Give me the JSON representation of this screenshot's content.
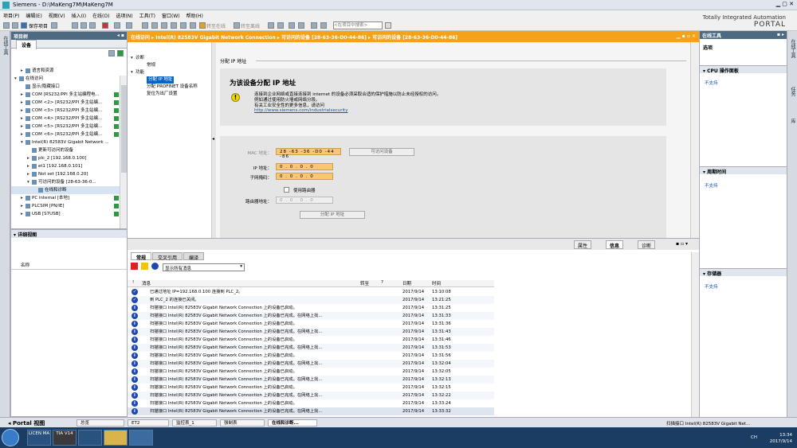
{
  "window": {
    "title": "Siemens  -  D:\\MaKeng7M\\MaKeng7M"
  },
  "menu": [
    "项目(P)",
    "编辑(E)",
    "视图(V)",
    "插入(I)",
    "在线(O)",
    "选项(N)",
    "工具(T)",
    "窗口(W)",
    "帮助(H)"
  ],
  "toolbar": {
    "save_project": "保存项目",
    "goto_online": "转至在线",
    "goto_offline": "转至离线",
    "search_placeholder": "<在项目中搜索>"
  },
  "brand": {
    "line1": "Totally Integrated Automation",
    "line2": "PORTAL"
  },
  "left_strip": {
    "label": "在线工具"
  },
  "project_tree": {
    "title": "项目树",
    "tab": "设备",
    "items": [
      {
        "label": "语言和资源",
        "indent": 1,
        "expand": "▸"
      },
      {
        "label": "在线访问",
        "indent": 0,
        "expand": "▾"
      },
      {
        "label": "显示/隐藏接口",
        "indent": 1,
        "expand": ""
      },
      {
        "label": "COM [RS232/PPI 多主站编程电...",
        "indent": 1,
        "expand": "▸"
      },
      {
        "label": "COM <2> [RS232/PPI 多主站编...",
        "indent": 1,
        "expand": "▸"
      },
      {
        "label": "COM <3> [RS232/PPI 多主站编...",
        "indent": 1,
        "expand": "▸"
      },
      {
        "label": "COM <4> [RS232/PPI 多主站编...",
        "indent": 1,
        "expand": "▸"
      },
      {
        "label": "COM <5> [RS232/PPI 多主站编...",
        "indent": 1,
        "expand": "▸"
      },
      {
        "label": "COM <6> [RS232/PPI 多主站编...",
        "indent": 1,
        "expand": "▸"
      },
      {
        "label": "Intel(R) 82583V Gigabit Network ...",
        "indent": 1,
        "expand": "▾"
      },
      {
        "label": "更新可访问的设备",
        "indent": 2,
        "expand": ""
      },
      {
        "label": "plc_2 [192.168.0.100]",
        "indent": 2,
        "expand": "▸"
      },
      {
        "label": "et1 [192.168.0.101]",
        "indent": 2,
        "expand": "▸"
      },
      {
        "label": "Not set [192.168.0.20]",
        "indent": 2,
        "expand": "▸"
      },
      {
        "label": "可访问的设备 [28-63-36-0...",
        "indent": 2,
        "expand": "▾"
      },
      {
        "label": "在线和诊断",
        "indent": 3,
        "expand": ""
      },
      {
        "label": "PC internal [本地]",
        "indent": 1,
        "expand": "▸"
      },
      {
        "label": "PLCSIM [PN/IE]",
        "indent": 1,
        "expand": "▸"
      },
      {
        "label": "USB [S7USB]",
        "indent": 1,
        "expand": "▸"
      }
    ]
  },
  "detail_view": {
    "title": "详细视图",
    "column": "名称"
  },
  "editor": {
    "title": "在线访问  ▸  Intel(R) 82583V Gigabit Network Connection  ▸  可访问的设备 [28-63-36-D0-44-86]  ▸  可访问的设备 [28-63-36-D0-44-86]",
    "nav": [
      {
        "label": "诊断",
        "indent": 0,
        "expand": "▾",
        "sel": false
      },
      {
        "label": "常规",
        "indent": 1,
        "expand": "",
        "sel": false
      },
      {
        "label": "功能",
        "indent": 0,
        "expand": "▾",
        "sel": false
      },
      {
        "label": "分配 IP 地址",
        "indent": 1,
        "expand": "",
        "sel": true
      },
      {
        "label": "分配 PROFINET 设备名称",
        "indent": 1,
        "expand": "",
        "sel": false
      },
      {
        "label": "复位为出厂设置",
        "indent": 1,
        "expand": "",
        "sel": false
      }
    ],
    "section_title": "分配 IP 地址",
    "heading": "为该设备分配 IP 地址",
    "warn_line1": "连接到企业网络或直接连接到 internet 的设备必须采取合适的保护措施以防止未经授权的访问。",
    "warn_line2": "例如通过使用防火墙或网络分段。",
    "warn_line3": "有关工业安全性的更多信息，请访问",
    "warn_link": "http://www.siemens.com/industrialsecurity",
    "mac_label": "MAC 地址：",
    "mac_value": "28 -63 -36 -D0 -44 -86",
    "accessible_button": "可访问设备",
    "ip_label": "IP 地址：",
    "ip_value": "0 . 0 . 0 . 0",
    "mask_label": "子网掩码：",
    "mask_value": "0 . 0 . 0 . 0",
    "router_check": "使用路由器",
    "router_label": "路由器地址：",
    "router_value": "0 . 0 . 0 . 0",
    "assign_button": "分配 IP 地址"
  },
  "inspector": {
    "right_tabs": [
      "属性",
      "信息",
      "诊断"
    ],
    "active_right_tab": "信息",
    "tabs": [
      "常规",
      "交叉引用",
      "编译"
    ],
    "active_tab": "常规",
    "filter": "显示所有消息",
    "columns": [
      "!",
      "消息",
      "转至",
      "?",
      "日期",
      "时间"
    ],
    "messages": [
      {
        "type": "ok",
        "text": "已通过地址 IP=192.168.0.100 连接到 PLC_2。",
        "date": "2017/9/14",
        "time": "13:10:08"
      },
      {
        "type": "ok",
        "text": "到 PLC_2 的连接已关闭。",
        "date": "2017/9/14",
        "time": "13:21:25"
      },
      {
        "type": "info",
        "text": "扫描接口 Intel(R) 82583V Gigabit Network Connection 上的设备已启动。",
        "date": "2017/9/14",
        "time": "13:31:25"
      },
      {
        "type": "info",
        "text": "扫描接口 Intel(R) 82583V Gigabit Network Connection 上的设备已完成。在网络上找...",
        "date": "2017/9/14",
        "time": "13:31:33"
      },
      {
        "type": "info",
        "text": "扫描接口 Intel(R) 82583V Gigabit Network Connection 上的设备已启动。",
        "date": "2017/9/14",
        "time": "13:31:36"
      },
      {
        "type": "info",
        "text": "扫描接口 Intel(R) 82583V Gigabit Network Connection 上的设备已完成。在网络上找...",
        "date": "2017/9/14",
        "time": "13:31:43"
      },
      {
        "type": "info",
        "text": "扫描接口 Intel(R) 82583V Gigabit Network Connection 上的设备已启动。",
        "date": "2017/9/14",
        "time": "13:31:46"
      },
      {
        "type": "info",
        "text": "扫描接口 Intel(R) 82583V Gigabit Network Connection 上的设备已完成。在网络上找...",
        "date": "2017/9/14",
        "time": "13:31:53"
      },
      {
        "type": "info",
        "text": "扫描接口 Intel(R) 82583V Gigabit Network Connection 上的设备已启动。",
        "date": "2017/9/14",
        "time": "13:31:56"
      },
      {
        "type": "info",
        "text": "扫描接口 Intel(R) 82583V Gigabit Network Connection 上的设备已完成。在网络上找...",
        "date": "2017/9/14",
        "time": "13:32:04"
      },
      {
        "type": "info",
        "text": "扫描接口 Intel(R) 82583V Gigabit Network Connection 上的设备已启动。",
        "date": "2017/9/14",
        "time": "13:32:05"
      },
      {
        "type": "info",
        "text": "扫描接口 Intel(R) 82583V Gigabit Network Connection 上的设备已完成。在网络上找...",
        "date": "2017/9/14",
        "time": "13:32:13"
      },
      {
        "type": "info",
        "text": "扫描接口 Intel(R) 82583V Gigabit Network Connection 上的设备已启动。",
        "date": "2017/9/14",
        "time": "13:32:15"
      },
      {
        "type": "info",
        "text": "扫描接口 Intel(R) 82583V Gigabit Network Connection 上的设备已完成。在网络上找...",
        "date": "2017/9/14",
        "time": "13:32:22"
      },
      {
        "type": "info",
        "text": "扫描接口 Intel(R) 82583V Gigabit Network Connection 上的设备已启动。",
        "date": "2017/9/14",
        "time": "13:33:24"
      },
      {
        "type": "info",
        "text": "扫描接口 Intel(R) 82583V Gigabit Network Connection 上的设备已完成。在网络上找...",
        "date": "2017/9/14",
        "time": "13:33:32"
      }
    ]
  },
  "task_panel": {
    "title": "在线工具",
    "options": "选项",
    "cpu_section": "CPU 操作面板",
    "cpu_text": "不支持",
    "cycle_section": "周期时间",
    "cycle_text": "不支持",
    "memory_section": "存储器",
    "memory_text": "不支持"
  },
  "right_strip": [
    "在线工具",
    "任务",
    "库"
  ],
  "portal_bar": {
    "portal_view": "Portal 视图",
    "tabs": [
      "总览",
      "ET2",
      "监控表_1",
      "强制表",
      "在线和诊断..."
    ],
    "status": "扫描接口 Intel(R) 82583V Gigabit Net..."
  },
  "taskbar": {
    "apps": [
      "LICEN MA",
      "TIA V14"
    ],
    "tray": "CH",
    "time": "13:34",
    "date": "2017/9/14"
  },
  "colors": {
    "accent": "#f5a219",
    "header": "#4e6a80",
    "info": "#1e47b0"
  }
}
